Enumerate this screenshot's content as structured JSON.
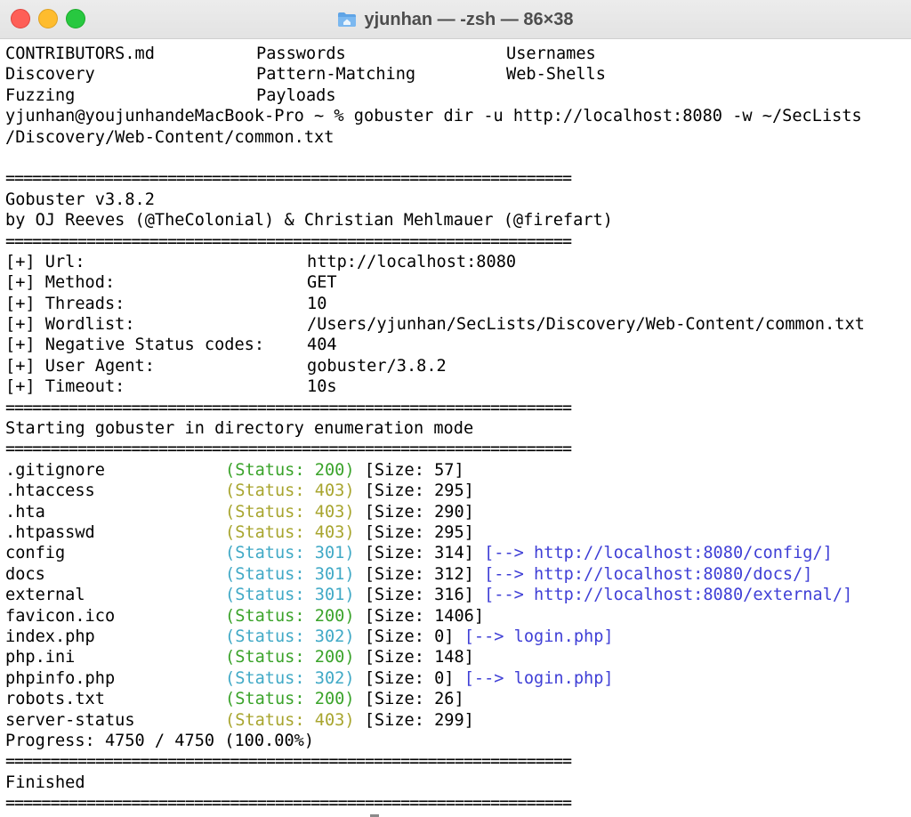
{
  "window": {
    "title": "yjunhan — -zsh — 86×38"
  },
  "colors": {
    "status_200": "#3aa32a",
    "status_403": "#a8a52e",
    "status_30x": "#40a9c6",
    "redirect": "#3f3fd6"
  },
  "terminal": {
    "ls_rows": [
      [
        "CONTRIBUTORS.md",
        "Passwords",
        "Usernames"
      ],
      [
        "Discovery",
        "Pattern-Matching",
        "Web-Shells"
      ],
      [
        "Fuzzing",
        "Payloads",
        ""
      ]
    ],
    "command_line_1": "yjunhan@youjunhandeMacBook-Pro ~ % gobuster dir -u http://localhost:8080 -w ~/SecLists",
    "command_line_2": "/Discovery/Web-Content/common.txt",
    "separator": "===============================================================",
    "banner_1": "Gobuster v3.8.2",
    "banner_2": "by OJ Reeves (@TheColonial) & Christian Mehlmauer (@firefart)",
    "config": [
      {
        "label": "[+] Url:",
        "value": "http://localhost:8080"
      },
      {
        "label": "[+] Method:",
        "value": "GET"
      },
      {
        "label": "[+] Threads:",
        "value": "10"
      },
      {
        "label": "[+] Wordlist:",
        "value": "/Users/yjunhan/SecLists/Discovery/Web-Content/common.txt"
      },
      {
        "label": "[+] Negative Status codes:",
        "value": "404"
      },
      {
        "label": "[+] User Agent:",
        "value": "gobuster/3.8.2"
      },
      {
        "label": "[+] Timeout:",
        "value": "10s"
      }
    ],
    "starting": "Starting gobuster in directory enumeration mode",
    "results": [
      {
        "name": ".gitignore",
        "status": "(Status: 200)",
        "code": "200",
        "size": "[Size: 57]",
        "redirect": ""
      },
      {
        "name": ".htaccess",
        "status": "(Status: 403)",
        "code": "403",
        "size": "[Size: 295]",
        "redirect": ""
      },
      {
        "name": ".hta",
        "status": "(Status: 403)",
        "code": "403",
        "size": "[Size: 290]",
        "redirect": ""
      },
      {
        "name": ".htpasswd",
        "status": "(Status: 403)",
        "code": "403",
        "size": "[Size: 295]",
        "redirect": ""
      },
      {
        "name": "config",
        "status": "(Status: 301)",
        "code": "301",
        "size": "[Size: 314]",
        "redirect": "[--> http://localhost:8080/config/]"
      },
      {
        "name": "docs",
        "status": "(Status: 301)",
        "code": "301",
        "size": "[Size: 312]",
        "redirect": "[--> http://localhost:8080/docs/]"
      },
      {
        "name": "external",
        "status": "(Status: 301)",
        "code": "301",
        "size": "[Size: 316]",
        "redirect": "[--> http://localhost:8080/external/]"
      },
      {
        "name": "favicon.ico",
        "status": "(Status: 200)",
        "code": "200",
        "size": "[Size: 1406]",
        "redirect": ""
      },
      {
        "name": "index.php",
        "status": "(Status: 302)",
        "code": "302",
        "size": "[Size: 0]",
        "redirect": "[--> login.php]"
      },
      {
        "name": "php.ini",
        "status": "(Status: 200)",
        "code": "200",
        "size": "[Size: 148]",
        "redirect": ""
      },
      {
        "name": "phpinfo.php",
        "status": "(Status: 302)",
        "code": "302",
        "size": "[Size: 0]",
        "redirect": "[--> login.php]"
      },
      {
        "name": "robots.txt",
        "status": "(Status: 200)",
        "code": "200",
        "size": "[Size: 26]",
        "redirect": ""
      },
      {
        "name": "server-status",
        "status": "(Status: 403)",
        "code": "403",
        "size": "[Size: 299]",
        "redirect": ""
      }
    ],
    "progress": "Progress: 4750 / 4750 (100.00%)",
    "finished": "Finished"
  }
}
